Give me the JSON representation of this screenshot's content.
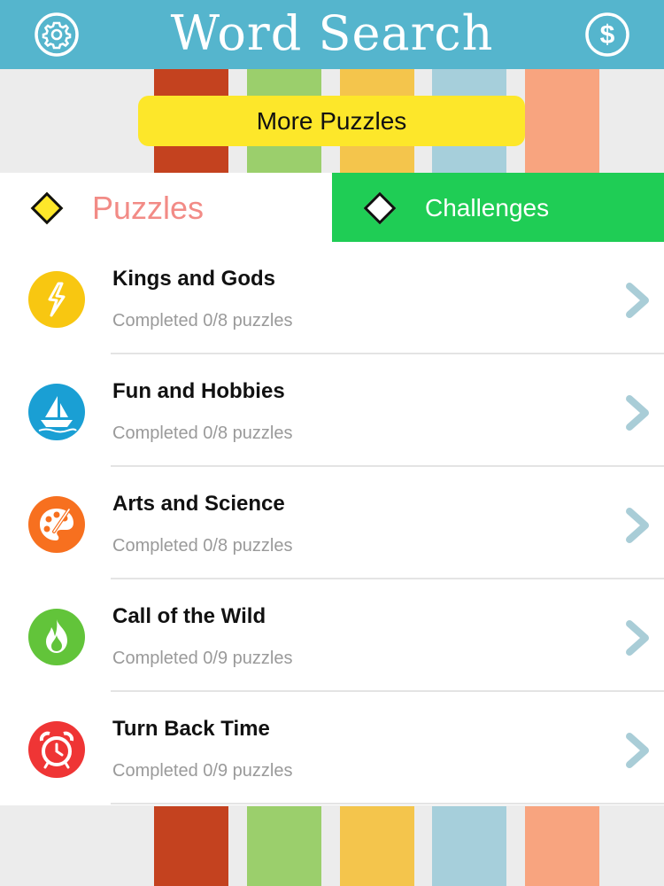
{
  "app": {
    "title": "Word Search"
  },
  "header": {
    "settings_icon": "gear-icon",
    "store_icon": "dollar-icon"
  },
  "banner": {
    "stripe_colors": [
      "#c4421f",
      "#9bcf6c",
      "#f4c54c",
      "#a6cfdb",
      "#f8a47f"
    ],
    "more_label": "More Puzzles"
  },
  "tabs": [
    {
      "label": "Puzzles",
      "selected": true
    },
    {
      "label": "Challenges",
      "selected": false
    }
  ],
  "categories": [
    {
      "name": "Kings and Gods",
      "status": "Completed 0/8 puzzles",
      "icon": "lightning-icon",
      "color": "#f8c711"
    },
    {
      "name": "Fun and Hobbies",
      "status": "Completed 0/8 puzzles",
      "icon": "sailboat-icon",
      "color": "#1a9fd4"
    },
    {
      "name": "Arts and Science",
      "status": "Completed 0/8 puzzles",
      "icon": "palette-icon",
      "color": "#f7701f"
    },
    {
      "name": "Call of the Wild",
      "status": "Completed 0/9 puzzles",
      "icon": "fire-icon",
      "color": "#62c43a"
    },
    {
      "name": "Turn Back Time",
      "status": "Completed 0/9 puzzles",
      "icon": "alarm-clock-icon",
      "color": "#ef3535"
    }
  ],
  "colors": {
    "header": "#55b5cd",
    "more_button": "#fde72a",
    "challenges_tab": "#1fcd55",
    "puzzles_tab_text": "#f28b86",
    "chevron": "#a9cdd7"
  }
}
